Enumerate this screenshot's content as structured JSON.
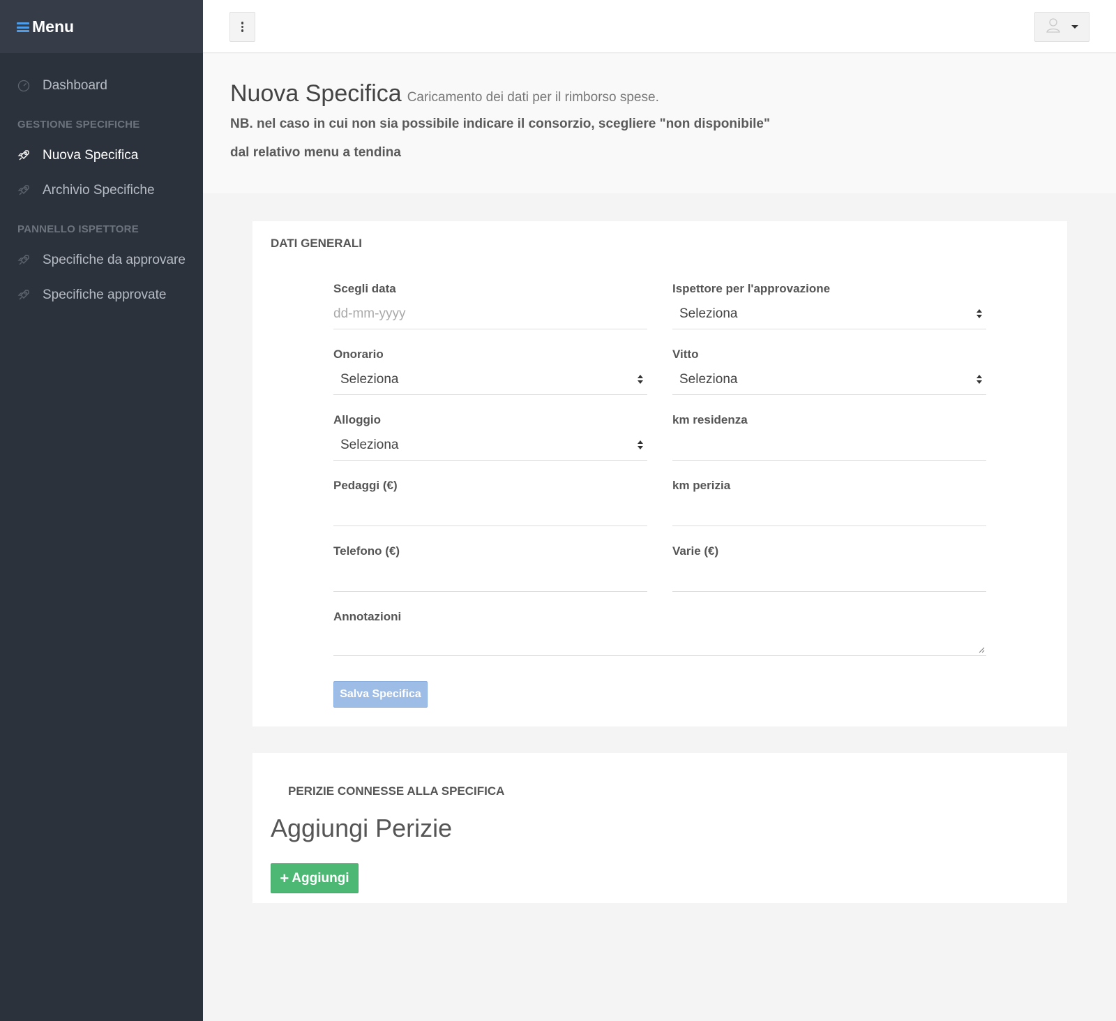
{
  "sidebar": {
    "title": "Menu",
    "items": {
      "dashboard": "Dashboard",
      "nuova": "Nuova Specifica",
      "archivio": "Archivio Specifiche",
      "da_approvare": "Specifiche da approvare",
      "approvate": "Specifiche approvate"
    },
    "sections": {
      "gestione": "GESTIONE SPECIFICHE",
      "pannello": "PANNELLO ISPETTORE"
    },
    "active_item": "Nuova Specifica"
  },
  "topbar": {
    "kebab_icon": "kebab-vertical-icon",
    "user_icon": "user-icon"
  },
  "header": {
    "title": "Nuova Specifica",
    "subtitle": "Caricamento dei dati per il rimborso spese.",
    "note": "NB. nel caso in cui non sia possibile indicare il consorzio, scegliere \"non disponibile\" dal relativo menu a tendina"
  },
  "form": {
    "section_title": "DATI GENERALI",
    "data": {
      "label": "Scegli data",
      "placeholder": "dd-mm-yyyy",
      "value": ""
    },
    "ispettore": {
      "label": "Ispettore per l'approvazione",
      "value": "Seleziona"
    },
    "onorario": {
      "label": "Onorario",
      "value": "Seleziona"
    },
    "vitto": {
      "label": "Vitto",
      "value": "Seleziona"
    },
    "alloggio": {
      "label": "Alloggio",
      "value": "Seleziona"
    },
    "km_residenza": {
      "label": "km residenza",
      "value": ""
    },
    "pedaggi": {
      "label": "Pedaggi (€)",
      "value": ""
    },
    "km_perizia": {
      "label": "km perizia",
      "value": ""
    },
    "telefono": {
      "label": "Telefono (€)",
      "value": ""
    },
    "varie": {
      "label": "Varie (€)",
      "value": ""
    },
    "annotazioni": {
      "label": "Annotazioni",
      "value": ""
    },
    "save_label": "Salva Specifica"
  },
  "perizie": {
    "section_title": "PERIZIE CONNESSE ALLA SPECIFICA",
    "heading": "Aggiungi Perizie",
    "add_label": "Aggiungi"
  },
  "colors": {
    "sidebar_bg": "#2c323c",
    "accent_blue": "#4f9de8",
    "save_button": "#9dbce6",
    "add_button": "#4cb874"
  }
}
